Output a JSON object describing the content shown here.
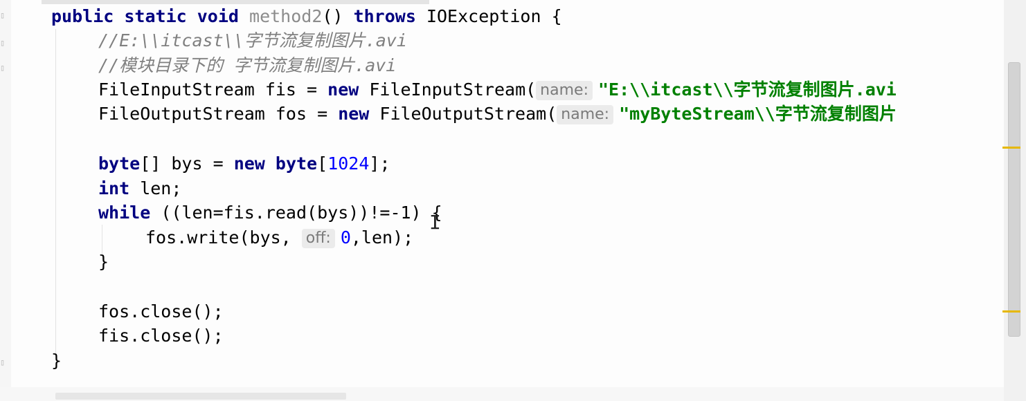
{
  "code": {
    "signature": {
      "public": "public",
      "static": "static",
      "void": "void",
      "method_name": "method2",
      "parens": "()",
      "throws": "throws",
      "exception": "IOException",
      "open_brace": "{"
    },
    "comment1": "//E:\\\\itcast\\\\字节流复制图片.avi",
    "comment2": "//模块目录下的 字节流复制图片.avi",
    "fis_line": {
      "prefix": "FileInputStream fis = ",
      "new_kw": "new",
      "ctor": " FileInputStream(",
      "hint": "name:",
      "string": "\"E:\\\\itcast\\\\字节流复制图片.avi"
    },
    "fos_line": {
      "prefix": "FileOutputStream fos = ",
      "new_kw": "new",
      "ctor": " FileOutputStream(",
      "hint": "name:",
      "string": "\"myByteStream\\\\字节流复制图片"
    },
    "byte_line": {
      "byte_kw": "byte",
      "mid": "[] bys = ",
      "new_kw": "new",
      "byte_kw2": "byte",
      "open": "[",
      "size": "1024",
      "close": "];"
    },
    "int_line": {
      "int_kw": "int",
      "rest": " len;"
    },
    "while_line": {
      "while_kw": "while",
      "cond": " ((len=fis.read(bys))!=-1) {"
    },
    "write_line": {
      "prefix": "fos.write(bys, ",
      "hint": "off:",
      "zero": "0",
      "rest": ",len);"
    },
    "close_while": "}",
    "fos_close": "fos.close();",
    "fis_close": "fis.close();",
    "method_close": "}"
  }
}
